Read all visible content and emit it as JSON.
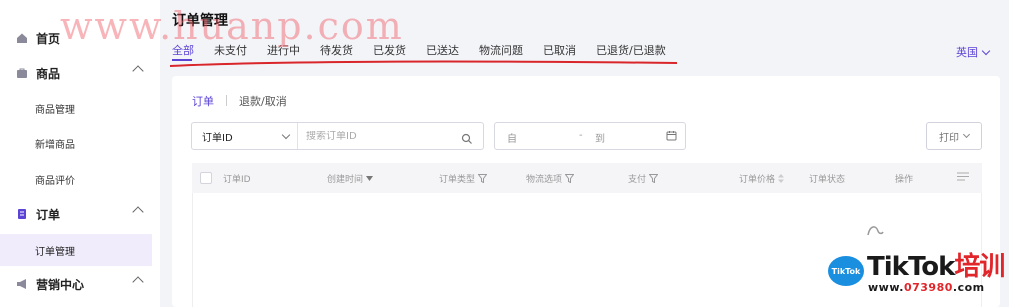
{
  "sidebar": {
    "items": [
      {
        "label": "首页"
      },
      {
        "label": "商品"
      },
      {
        "label": "订单"
      },
      {
        "label": "营销中心"
      }
    ],
    "sub_products": [
      "商品管理",
      "新增商品",
      "商品评价"
    ],
    "sub_orders": [
      "订单管理"
    ]
  },
  "header": {
    "title": "订单管理",
    "tabs": [
      "全部",
      "未支付",
      "进行中",
      "待发货",
      "已发货",
      "已送达",
      "物流问题",
      "已取消",
      "已退货/已退款"
    ],
    "language": "英国"
  },
  "main": {
    "subtabs": [
      "订单",
      "退款/取消"
    ],
    "filter": {
      "field": "订单ID",
      "placeholder": "搜索订单ID"
    },
    "date_range": {
      "from": "自",
      "sep": "-",
      "to": "到"
    },
    "print_label": "打印",
    "columns": [
      "订单ID",
      "创建时间",
      "订单类型",
      "物流选项",
      "支付",
      "订单价格",
      "订单状态",
      "操作"
    ]
  },
  "overlays": {
    "watermark": "www.huanp.com",
    "logo_badge": "TikTok",
    "brand_text": "TikTok",
    "brand_highlight": "培训",
    "brand_url_prefix": "www.",
    "brand_url_num": "073980",
    "brand_url_suffix": ".com"
  },
  "colors": {
    "accent": "#5b43d6",
    "annotation_red": "#d9262b"
  }
}
